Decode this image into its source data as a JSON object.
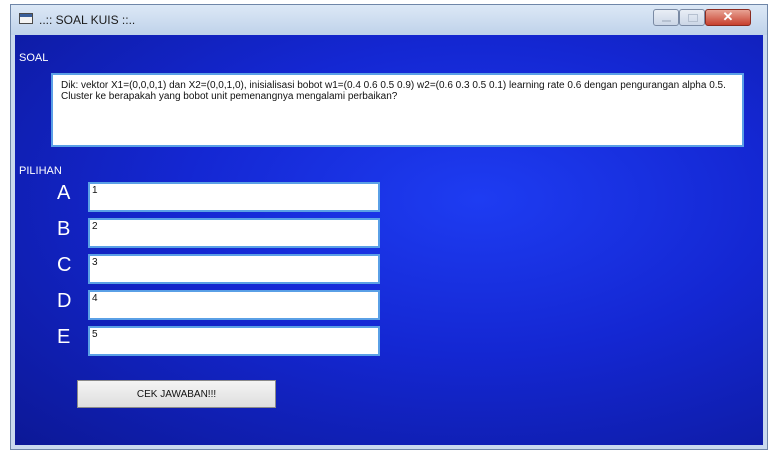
{
  "window": {
    "title": "..:: SOAL KUIS ::..",
    "icon": "app-window-icon",
    "controls": [
      "minimize-icon",
      "maximize-icon",
      "close-icon"
    ],
    "close_glyph": "✕"
  },
  "soal": {
    "label": "SOAL",
    "question": "Dik: vektor X1=(0,0,0,1) dan X2=(0,0,1,0), inisialisasi bobot w1=(0.4 0.6 0.5 0.9) w2=(0.6 0.3 0.5 0.1) learning rate 0.6 dengan pengurangan alpha 0.5. Cluster ke berapakah yang bobot unit pemenangnya mengalami perbaikan?"
  },
  "pilihan": {
    "label": "PILIHAN",
    "options": [
      {
        "letter": "A",
        "value": "1"
      },
      {
        "letter": "B",
        "value": "2"
      },
      {
        "letter": "C",
        "value": "3"
      },
      {
        "letter": "D",
        "value": "4"
      },
      {
        "letter": "E",
        "value": "5"
      }
    ]
  },
  "check_button": {
    "label": "CEK JAWABAN!!!"
  },
  "colors": {
    "client_background": "#1427d2",
    "input_border": "#5aa0e6",
    "titlebar": "#c9d9ee"
  }
}
